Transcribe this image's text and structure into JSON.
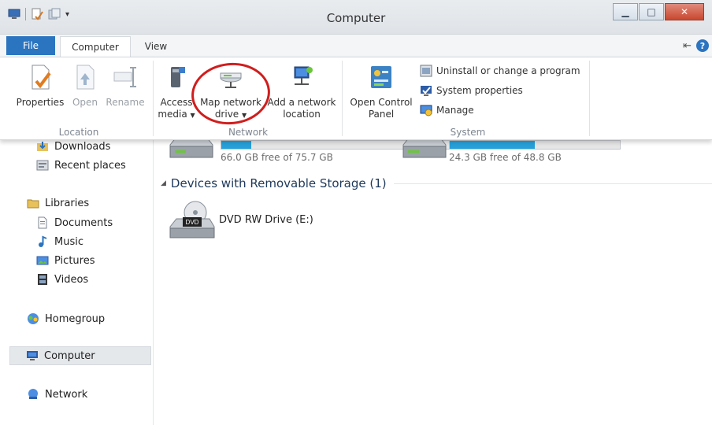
{
  "window": {
    "title": "Computer"
  },
  "ribbon_tabs": {
    "file": "File",
    "computer": "Computer",
    "view": "View"
  },
  "ribbon": {
    "location": {
      "label": "Location",
      "properties": "Properties",
      "open": "Open",
      "rename": "Rename"
    },
    "network": {
      "label": "Network",
      "access_media_l1": "Access",
      "access_media_l2": "media",
      "map_drive_l1": "Map network",
      "map_drive_l2": "drive",
      "add_location_l1": "Add a network",
      "add_location_l2": "location"
    },
    "system": {
      "label": "System",
      "control_panel_l1": "Open Control",
      "control_panel_l2": "Panel",
      "uninstall": "Uninstall or change a program",
      "system_properties": "System properties",
      "manage": "Manage"
    }
  },
  "nav": {
    "downloads": "Downloads",
    "recent_places": "Recent places",
    "libraries": "Libraries",
    "documents": "Documents",
    "music": "Music",
    "pictures": "Pictures",
    "videos": "Videos",
    "homegroup": "Homegroup",
    "computer": "Computer",
    "network": "Network"
  },
  "content": {
    "drive1": {
      "free_text": "66.0 GB free of 75.7 GB",
      "used_fraction": 0.13
    },
    "drive2": {
      "free_text": "24.3 GB free of 48.8 GB",
      "used_fraction": 0.5
    },
    "removable_header": "Devices with Removable Storage (1)",
    "dvd": {
      "label": "DVD RW Drive (E:)",
      "badge": "DVD"
    }
  },
  "colors": {
    "accent": "#2b74c0",
    "highlight": "#d11d1d",
    "bar_fill": "#26a0da"
  }
}
